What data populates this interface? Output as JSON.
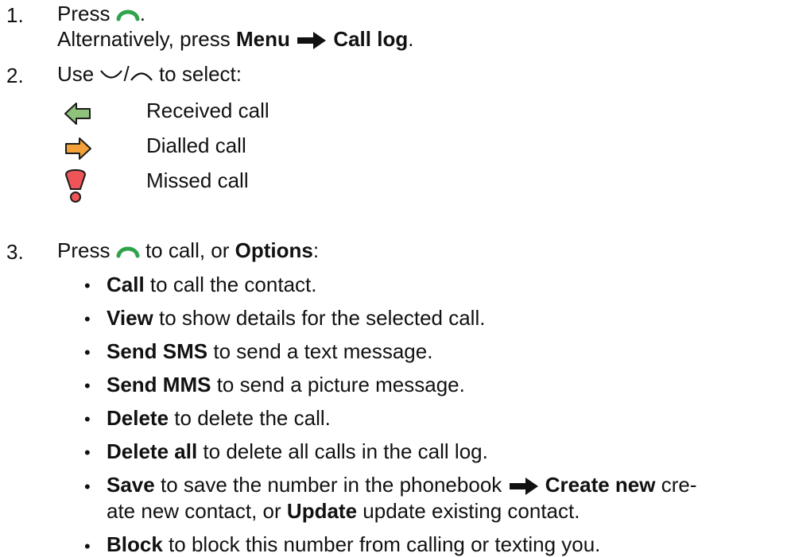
{
  "steps": [
    {
      "number": "1.",
      "prefix": "Press",
      "suffix": ".",
      "alt_prefix": "Alternatively, press",
      "menu": "Menu",
      "call_log": "Call log",
      "alt_suffix": "."
    },
    {
      "number": "2.",
      "prefix": "Use",
      "slash": "/",
      "suffix": "to select:"
    },
    {
      "number": "3.",
      "prefix": "Press",
      "middle": "to call, or",
      "options": "Options",
      "suffix": ":"
    }
  ],
  "legend": [
    {
      "icon": "received-call-arrow-icon",
      "label": "Received call",
      "color": "#8fc27a"
    },
    {
      "icon": "dialled-call-arrow-icon",
      "label": "Dialled call",
      "color": "#f5a13a"
    },
    {
      "icon": "missed-call-exclamation-icon",
      "label": "Missed call",
      "color": "#ef5558"
    }
  ],
  "options": [
    {
      "term": "Call",
      "text": "to call the contact."
    },
    {
      "term": "View",
      "text": "to show details for the selected call."
    },
    {
      "term": "Send SMS",
      "text": "to send a text message."
    },
    {
      "term": "Send MMS",
      "text": "to send a picture message."
    },
    {
      "term": "Delete",
      "text": "to delete the call."
    },
    {
      "term": "Delete all",
      "text": "to delete all calls in the call log."
    },
    {
      "term": "Save",
      "text": "to save the number in the phonebook",
      "create_new": "Create new",
      "text2": "cre-",
      "line2": "ate new contact, or",
      "update": "Update",
      "line2_end": "update existing contact."
    },
    {
      "term": "Block",
      "text": "to block this number from calling or texting you."
    }
  ],
  "colors": {
    "call_key": "#2ea34a",
    "text": "#111111"
  }
}
